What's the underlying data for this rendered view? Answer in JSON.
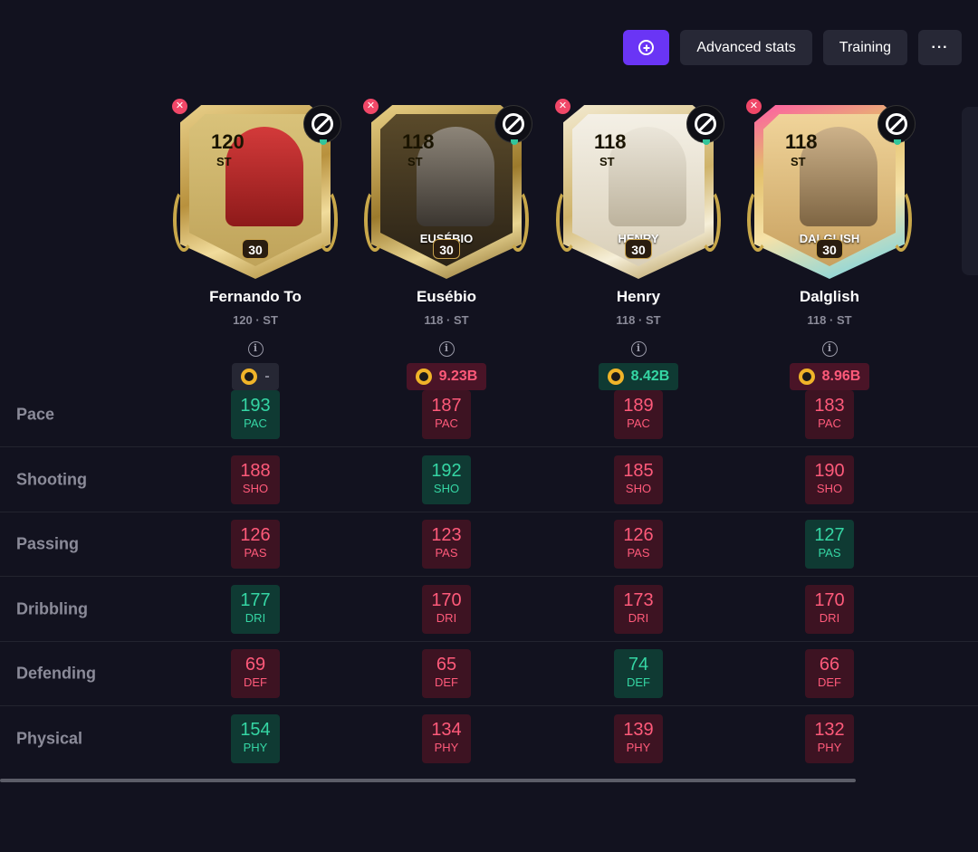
{
  "toolbar": {
    "compare_icon": "plus-circle-icon",
    "advanced_label": "Advanced stats",
    "training_label": "Training",
    "more_label": "···"
  },
  "colors": {
    "accent": "#6a35f5",
    "better": "#35d6a4",
    "worse": "#ff5a7a",
    "background": "#12121f"
  },
  "players": [
    {
      "card_rating": "120",
      "card_position": "ST",
      "card_name": "",
      "card_chem": "30",
      "name": "Fernando To",
      "sub": "120 · ST",
      "price": "-",
      "price_tone": "neutral",
      "card_theme": "red-gold"
    },
    {
      "card_rating": "118",
      "card_position": "ST",
      "card_name": "EUSÉBIO",
      "card_chem": "30",
      "name": "Eusébio",
      "sub": "118 · ST",
      "price": "9.23B",
      "price_tone": "red",
      "card_theme": "dark-gold"
    },
    {
      "card_rating": "118",
      "card_position": "ST",
      "card_name": "HENRY",
      "card_chem": "30",
      "name": "Henry",
      "sub": "118 · ST",
      "price": "8.42B",
      "price_tone": "green",
      "card_theme": "white-gold"
    },
    {
      "card_rating": "118",
      "card_position": "ST",
      "card_name": "DALGLISH",
      "card_chem": "30",
      "name": "Dalglish",
      "sub": "118 · ST",
      "price": "8.96B",
      "price_tone": "red",
      "card_theme": "sepia-gold"
    }
  ],
  "stats": [
    {
      "label": "Pace",
      "abbr": "PAC",
      "values": [
        "193",
        "187",
        "189",
        "183"
      ],
      "tones": [
        "green",
        "red",
        "red",
        "red"
      ]
    },
    {
      "label": "Shooting",
      "abbr": "SHO",
      "values": [
        "188",
        "192",
        "185",
        "190"
      ],
      "tones": [
        "red",
        "green",
        "red",
        "red"
      ]
    },
    {
      "label": "Passing",
      "abbr": "PAS",
      "values": [
        "126",
        "123",
        "126",
        "127"
      ],
      "tones": [
        "red",
        "red",
        "red",
        "green"
      ]
    },
    {
      "label": "Dribbling",
      "abbr": "DRI",
      "values": [
        "177",
        "170",
        "173",
        "170"
      ],
      "tones": [
        "green",
        "red",
        "red",
        "red"
      ]
    },
    {
      "label": "Defending",
      "abbr": "DEF",
      "values": [
        "69",
        "65",
        "74",
        "66"
      ],
      "tones": [
        "red",
        "red",
        "green",
        "red"
      ]
    },
    {
      "label": "Physical",
      "abbr": "PHY",
      "values": [
        "154",
        "134",
        "139",
        "132"
      ],
      "tones": [
        "green",
        "red",
        "red",
        "red"
      ]
    }
  ]
}
